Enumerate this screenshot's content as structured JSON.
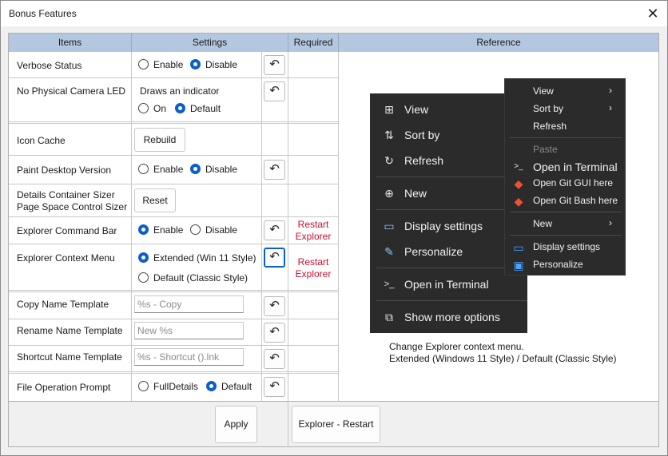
{
  "window": {
    "title": "Bonus Features",
    "close_glyph": "✕"
  },
  "table": {
    "headers": {
      "items": "Items",
      "settings": "Settings",
      "required": "Required",
      "reference": "Reference"
    }
  },
  "rows": {
    "verbose": {
      "label": "Verbose Status",
      "opt1": "Enable",
      "opt2": "Disable",
      "selected": "Disable"
    },
    "camera": {
      "label": "No Physical Camera LED",
      "caption": "Draws an indicator",
      "opt1": "On",
      "opt2": "Default",
      "selected": "Default"
    },
    "iconcache": {
      "label": "Icon Cache",
      "button": "Rebuild"
    },
    "paint": {
      "label": "Paint Desktop Version",
      "opt1": "Enable",
      "opt2": "Disable",
      "selected": "Disable"
    },
    "sizer": {
      "label1": "Details Container Sizer",
      "label2": "Page Space Control Sizer",
      "button": "Reset"
    },
    "cmdbar": {
      "label": "Explorer Command Bar",
      "opt1": "Enable",
      "opt2": "Disable",
      "selected": "Enable",
      "required1": "Restart",
      "required2": "Explorer"
    },
    "ctxmenu": {
      "label": "Explorer Context Menu",
      "opt1": "Extended (Win 11 Style)",
      "opt2": "Default (Classic Style)",
      "selected": "Extended (Win 11 Style)",
      "required1": "Restart",
      "required2": "Explorer"
    },
    "copyname": {
      "label": "Copy Name Template",
      "placeholder": "%s - Copy"
    },
    "renamename": {
      "label": "Rename Name Template",
      "placeholder": "New %s"
    },
    "shortcutname": {
      "label": "Shortcut Name Template",
      "placeholder": "%s - Shortcut ().lnk"
    },
    "fileop": {
      "label": "File Operation Prompt",
      "opt1": "FullDetails",
      "opt2": "Default",
      "selected": "Default"
    }
  },
  "undo_glyph": "↶",
  "footer": {
    "apply": "Apply",
    "restart": "Explorer - Restart"
  },
  "reference": {
    "win11_menu": {
      "items": [
        "View",
        "Sort by",
        "Refresh",
        "New",
        "Display settings",
        "Personalize",
        "Open in Terminal",
        "Show more options"
      ],
      "icons": [
        "grid-icon",
        "sort-icon",
        "refresh-icon",
        "plus-circle-icon",
        "display-icon",
        "brush-icon",
        "terminal-icon",
        "external-icon"
      ]
    },
    "classic_menu": {
      "items": [
        "View",
        "Sort by",
        "Refresh",
        "Paste",
        "Open in Terminal",
        "Open Git GUI here",
        "Open Git Bash here",
        "New",
        "Display settings",
        "Personalize"
      ]
    },
    "caption1": "Change Explorer context menu.",
    "caption2": "Extended (Windows 11 Style) / Default (Classic Style)"
  },
  "colors": {
    "header_bg": "#b3c7e0",
    "accent": "#0a5fc9",
    "required_text": "#c8102e",
    "menu_bg": "#2b2b2b"
  }
}
